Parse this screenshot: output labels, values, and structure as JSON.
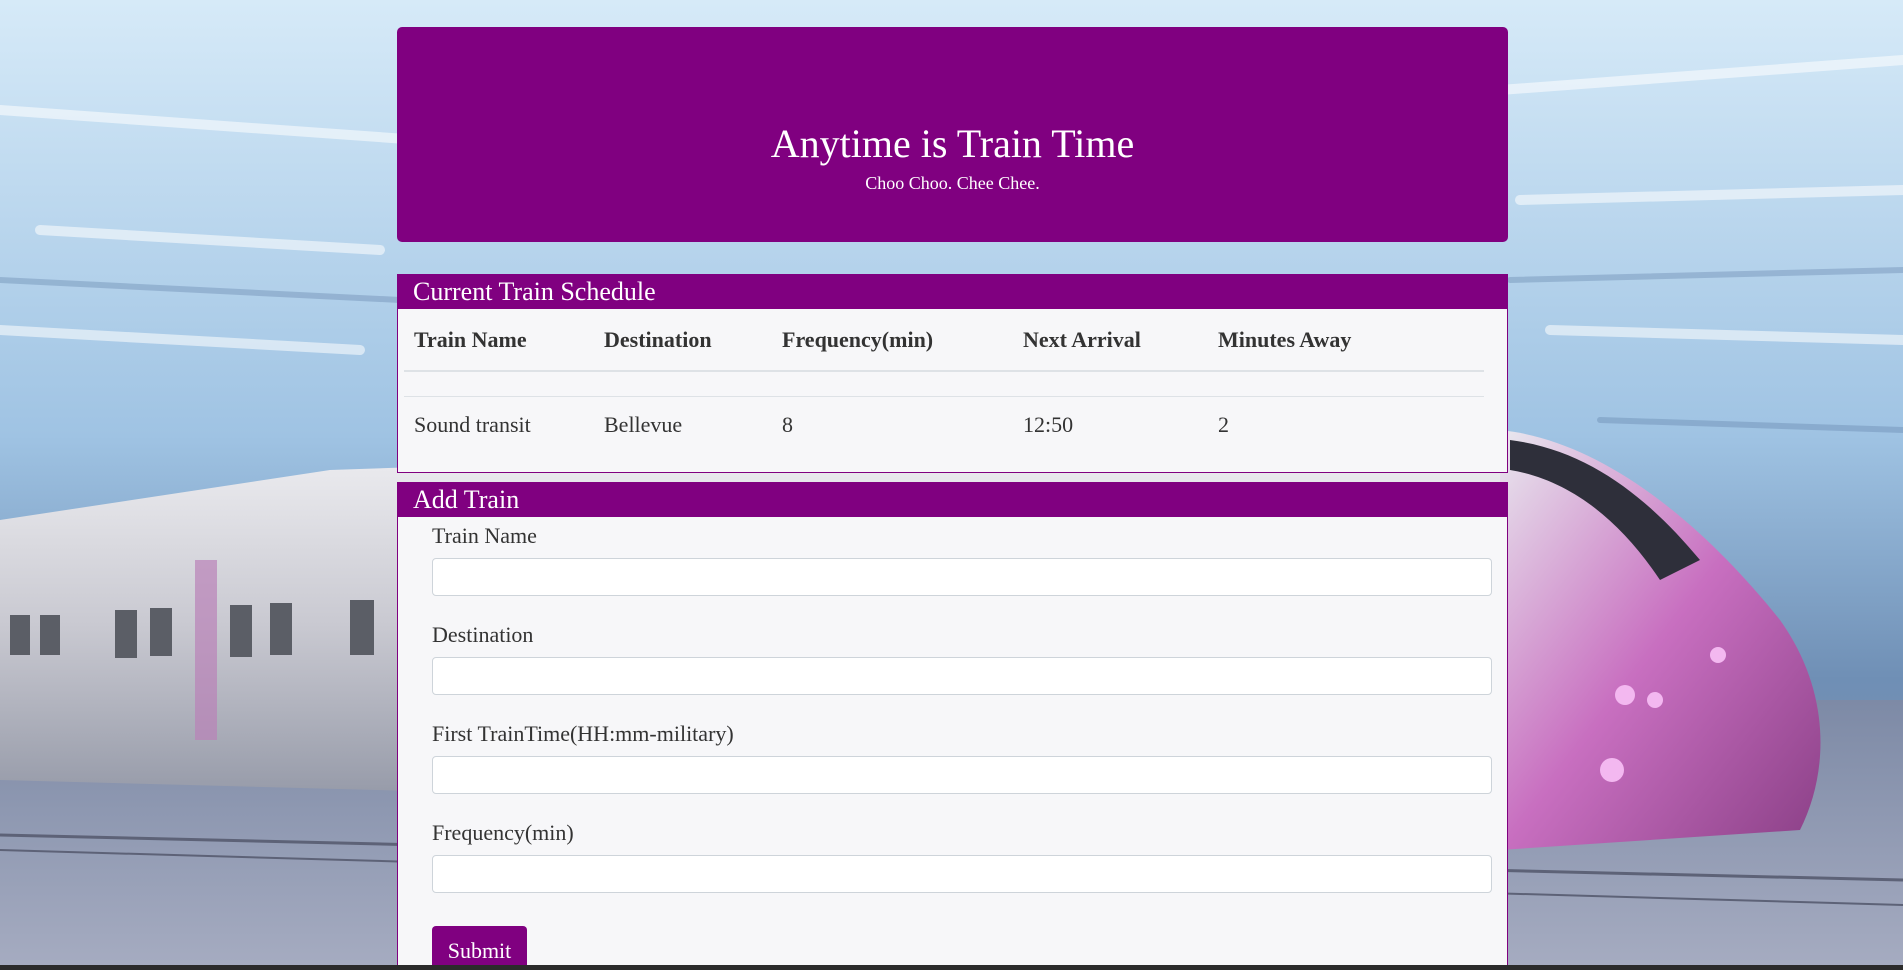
{
  "header": {
    "title": "Anytime is Train Time",
    "subtitle": "Choo Choo. Chee Chee."
  },
  "schedule": {
    "heading": "Current Train Schedule",
    "columns": [
      "Train Name",
      "Destination",
      "Frequency(min)",
      "Next Arrival",
      "Minutes Away"
    ],
    "rows": [
      [
        "Sound transit",
        "Bellevue",
        "8",
        "12:50",
        "2"
      ]
    ]
  },
  "add_train": {
    "heading": "Add Train",
    "fields": [
      {
        "label": "Train Name",
        "value": "",
        "placeholder": ""
      },
      {
        "label": "Destination",
        "value": "",
        "placeholder": ""
      },
      {
        "label": "First TrainTime(HH:mm-military)",
        "value": "",
        "placeholder": ""
      },
      {
        "label": "Frequency(min)",
        "value": "",
        "placeholder": ""
      }
    ],
    "submit_label": "Submit"
  },
  "colors": {
    "accent": "#800080",
    "panel_bg": "#f7f7f9"
  }
}
